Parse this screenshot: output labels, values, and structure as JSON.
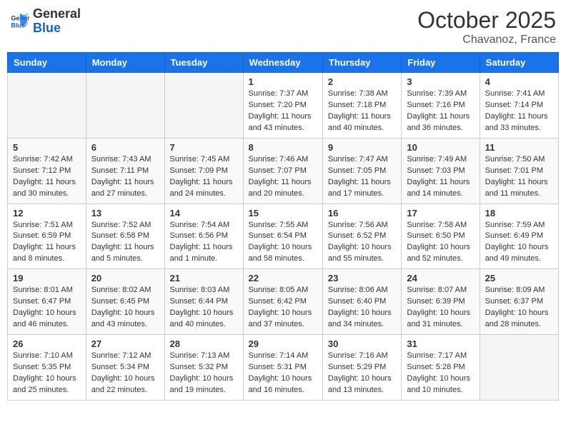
{
  "logo": {
    "line1": "General",
    "line2": "Blue"
  },
  "title": "October 2025",
  "location": "Chavanoz, France",
  "weekdays": [
    "Sunday",
    "Monday",
    "Tuesday",
    "Wednesday",
    "Thursday",
    "Friday",
    "Saturday"
  ],
  "rows": [
    [
      {
        "day": "",
        "info": ""
      },
      {
        "day": "",
        "info": ""
      },
      {
        "day": "",
        "info": ""
      },
      {
        "day": "1",
        "info": "Sunrise: 7:37 AM\nSunset: 7:20 PM\nDaylight: 11 hours and 43 minutes."
      },
      {
        "day": "2",
        "info": "Sunrise: 7:38 AM\nSunset: 7:18 PM\nDaylight: 11 hours and 40 minutes."
      },
      {
        "day": "3",
        "info": "Sunrise: 7:39 AM\nSunset: 7:16 PM\nDaylight: 11 hours and 36 minutes."
      },
      {
        "day": "4",
        "info": "Sunrise: 7:41 AM\nSunset: 7:14 PM\nDaylight: 11 hours and 33 minutes."
      }
    ],
    [
      {
        "day": "5",
        "info": "Sunrise: 7:42 AM\nSunset: 7:12 PM\nDaylight: 11 hours and 30 minutes."
      },
      {
        "day": "6",
        "info": "Sunrise: 7:43 AM\nSunset: 7:11 PM\nDaylight: 11 hours and 27 minutes."
      },
      {
        "day": "7",
        "info": "Sunrise: 7:45 AM\nSunset: 7:09 PM\nDaylight: 11 hours and 24 minutes."
      },
      {
        "day": "8",
        "info": "Sunrise: 7:46 AM\nSunset: 7:07 PM\nDaylight: 11 hours and 20 minutes."
      },
      {
        "day": "9",
        "info": "Sunrise: 7:47 AM\nSunset: 7:05 PM\nDaylight: 11 hours and 17 minutes."
      },
      {
        "day": "10",
        "info": "Sunrise: 7:49 AM\nSunset: 7:03 PM\nDaylight: 11 hours and 14 minutes."
      },
      {
        "day": "11",
        "info": "Sunrise: 7:50 AM\nSunset: 7:01 PM\nDaylight: 11 hours and 11 minutes."
      }
    ],
    [
      {
        "day": "12",
        "info": "Sunrise: 7:51 AM\nSunset: 6:59 PM\nDaylight: 11 hours and 8 minutes."
      },
      {
        "day": "13",
        "info": "Sunrise: 7:52 AM\nSunset: 6:58 PM\nDaylight: 11 hours and 5 minutes."
      },
      {
        "day": "14",
        "info": "Sunrise: 7:54 AM\nSunset: 6:56 PM\nDaylight: 11 hours and 1 minute."
      },
      {
        "day": "15",
        "info": "Sunrise: 7:55 AM\nSunset: 6:54 PM\nDaylight: 10 hours and 58 minutes."
      },
      {
        "day": "16",
        "info": "Sunrise: 7:56 AM\nSunset: 6:52 PM\nDaylight: 10 hours and 55 minutes."
      },
      {
        "day": "17",
        "info": "Sunrise: 7:58 AM\nSunset: 6:50 PM\nDaylight: 10 hours and 52 minutes."
      },
      {
        "day": "18",
        "info": "Sunrise: 7:59 AM\nSunset: 6:49 PM\nDaylight: 10 hours and 49 minutes."
      }
    ],
    [
      {
        "day": "19",
        "info": "Sunrise: 8:01 AM\nSunset: 6:47 PM\nDaylight: 10 hours and 46 minutes."
      },
      {
        "day": "20",
        "info": "Sunrise: 8:02 AM\nSunset: 6:45 PM\nDaylight: 10 hours and 43 minutes."
      },
      {
        "day": "21",
        "info": "Sunrise: 8:03 AM\nSunset: 6:44 PM\nDaylight: 10 hours and 40 minutes."
      },
      {
        "day": "22",
        "info": "Sunrise: 8:05 AM\nSunset: 6:42 PM\nDaylight: 10 hours and 37 minutes."
      },
      {
        "day": "23",
        "info": "Sunrise: 8:06 AM\nSunset: 6:40 PM\nDaylight: 10 hours and 34 minutes."
      },
      {
        "day": "24",
        "info": "Sunrise: 8:07 AM\nSunset: 6:39 PM\nDaylight: 10 hours and 31 minutes."
      },
      {
        "day": "25",
        "info": "Sunrise: 8:09 AM\nSunset: 6:37 PM\nDaylight: 10 hours and 28 minutes."
      }
    ],
    [
      {
        "day": "26",
        "info": "Sunrise: 7:10 AM\nSunset: 5:35 PM\nDaylight: 10 hours and 25 minutes."
      },
      {
        "day": "27",
        "info": "Sunrise: 7:12 AM\nSunset: 5:34 PM\nDaylight: 10 hours and 22 minutes."
      },
      {
        "day": "28",
        "info": "Sunrise: 7:13 AM\nSunset: 5:32 PM\nDaylight: 10 hours and 19 minutes."
      },
      {
        "day": "29",
        "info": "Sunrise: 7:14 AM\nSunset: 5:31 PM\nDaylight: 10 hours and 16 minutes."
      },
      {
        "day": "30",
        "info": "Sunrise: 7:16 AM\nSunset: 5:29 PM\nDaylight: 10 hours and 13 minutes."
      },
      {
        "day": "31",
        "info": "Sunrise: 7:17 AM\nSunset: 5:28 PM\nDaylight: 10 hours and 10 minutes."
      },
      {
        "day": "",
        "info": ""
      }
    ]
  ]
}
